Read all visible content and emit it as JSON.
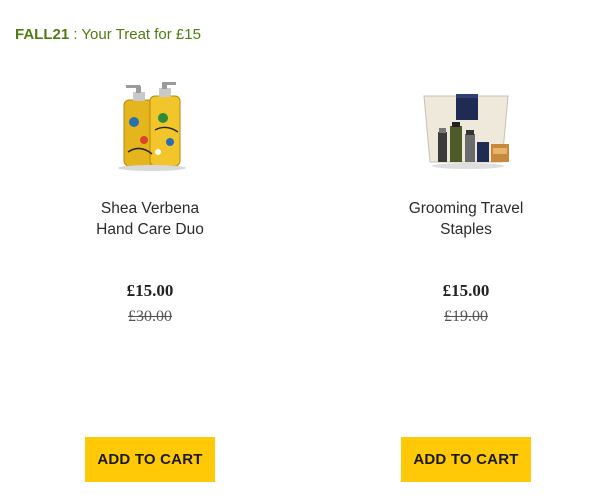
{
  "promo": {
    "code": "FALL21",
    "separator": " : ",
    "text": "Your Treat for £15"
  },
  "products": [
    {
      "name_line1": "Shea Verbena",
      "name_line2": "Hand Care Duo",
      "price": "£15.00",
      "old_price": "£30.00",
      "cart_label": "ADD TO CART",
      "image": "hand-care-duo-bottles-image"
    },
    {
      "name_line1": "Grooming Travel",
      "name_line2": "Staples",
      "price": "£15.00",
      "old_price": "£19.00",
      "cart_label": "ADD TO CART",
      "image": "grooming-travel-kit-image"
    }
  ],
  "colors": {
    "promo": "#4f7d12",
    "button": "#ffc907"
  }
}
